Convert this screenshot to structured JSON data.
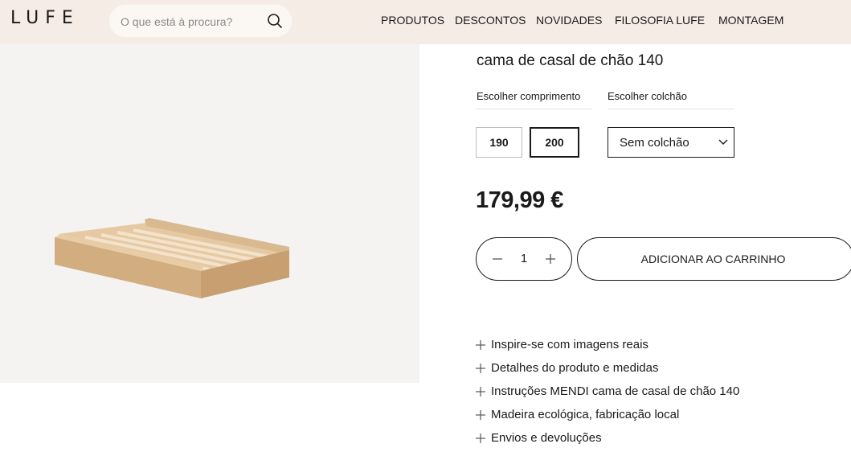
{
  "header": {
    "logo": "LUFE",
    "search": {
      "placeholder": "O que está à procura?"
    },
    "nav": [
      "PRODUTOS",
      "DESCONTOS",
      "NOVIDADES",
      "FILOSOFIA LUFE",
      "MONTAGEM"
    ]
  },
  "product": {
    "title": "cama de casal de chão 140",
    "length_label": "Escolher comprimento",
    "mattress_label": "Escolher colchão",
    "lengths": [
      "190",
      "200"
    ],
    "selected_length": "200",
    "mattress_value": "Sem colchão",
    "price": "179,99 €",
    "quantity": "1",
    "add_to_cart": "ADICIONAR AO CARRINHO"
  },
  "accordion": [
    "Inspire-se com imagens reais",
    "Detalhes do produto e medidas",
    "Instruções MENDI cama de casal de chão 140",
    "Madeira ecológica, fabricação local",
    "Envios e devoluções"
  ],
  "icons": {
    "search": "search-icon",
    "chevron": "chevron-down-icon",
    "minus": "minus-icon",
    "plus": "plus-icon"
  },
  "colors": {
    "header_bg": "#f5ede5",
    "image_bg": "#f4f3f1",
    "text": "#1a1a1a"
  }
}
